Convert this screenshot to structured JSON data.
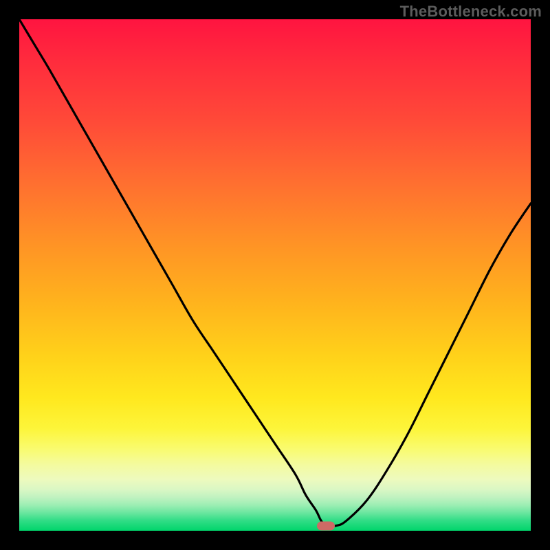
{
  "watermark": "TheBottleneck.com",
  "colors": {
    "frame": "#000000",
    "curve": "#000000",
    "marker": "#cd6a65"
  },
  "chart_data": {
    "type": "line",
    "title": "",
    "xlabel": "",
    "ylabel": "",
    "xlim": [
      0,
      100
    ],
    "ylim": [
      0,
      100
    ],
    "x": [
      0,
      3,
      6,
      10,
      14,
      18,
      22,
      26,
      30,
      34,
      38,
      42,
      46,
      50,
      54,
      56,
      58,
      59,
      60,
      62,
      64,
      68,
      72,
      76,
      80,
      84,
      88,
      92,
      96,
      100
    ],
    "values": [
      100,
      95,
      90,
      83,
      76,
      69,
      62,
      55,
      48,
      41,
      35,
      29,
      23,
      17,
      11,
      7,
      4,
      2,
      1,
      1,
      2,
      6,
      12,
      19,
      27,
      35,
      43,
      51,
      58,
      64
    ],
    "minimum": {
      "x": 60,
      "y": 1
    },
    "background_gradient": {
      "top": "#ff1440",
      "bottom": "#00d56b"
    }
  }
}
